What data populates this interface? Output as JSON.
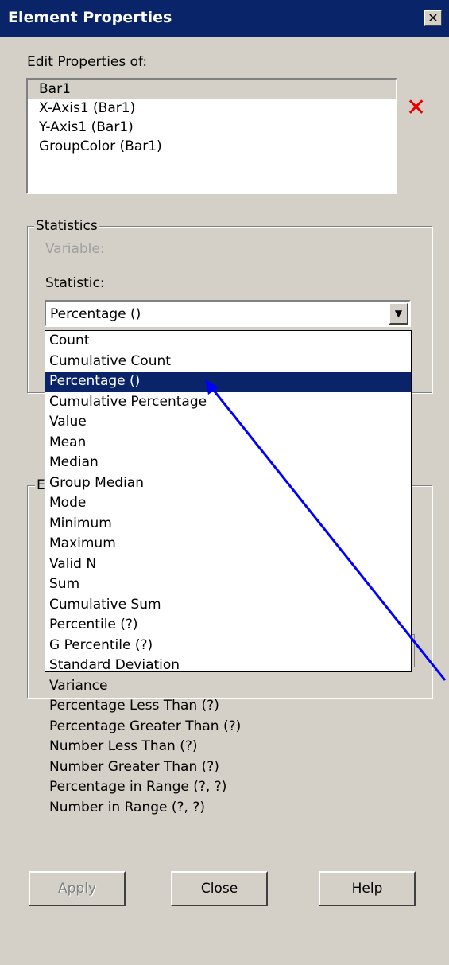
{
  "window": {
    "title": "Element Properties",
    "close_glyph": "✕"
  },
  "edit_properties": {
    "label": "Edit Properties of:",
    "items": [
      {
        "label": "Bar1",
        "selected": true
      },
      {
        "label": "X-Axis1 (Bar1)",
        "selected": false
      },
      {
        "label": "Y-Axis1 (Bar1)",
        "selected": false
      },
      {
        "label": "GroupColor (Bar1)",
        "selected": false
      }
    ],
    "delete_icon": "red-x-icon",
    "delete_glyph": "✕"
  },
  "statistics": {
    "group_label": "Statistics",
    "variable_label": "Variable:",
    "statistic_label": "Statistic:",
    "selected_value": "Percentage ()",
    "arrow_glyph": "▼",
    "options": [
      "Count",
      "Cumulative Count",
      "Percentage ()",
      "Cumulative Percentage",
      "Value",
      "Mean",
      "Median",
      "Group Median",
      "Mode",
      "Minimum",
      "Maximum",
      "Valid N",
      "Sum",
      "Cumulative Sum",
      "Percentile (?)",
      "G Percentile (?)",
      "Standard Deviation",
      "Variance",
      "Percentage Less Than (?)",
      "Percentage Greater Than (?)",
      "Number Less Than (?)",
      "Number Greater Than (?)",
      "Percentage in Range (?, ?)",
      "Number in Range (?, ?)"
    ],
    "selected_index": 2
  },
  "second_group": {
    "label_fragment": "E"
  },
  "buttons": {
    "apply": "Apply",
    "close": "Close",
    "help": "Help"
  },
  "colors": {
    "titlebar": "#0a246a",
    "selection": "#0a246a",
    "face": "#d4d0c8",
    "annotation_arrow": "#0000ff",
    "delete_icon": "#e60000"
  }
}
